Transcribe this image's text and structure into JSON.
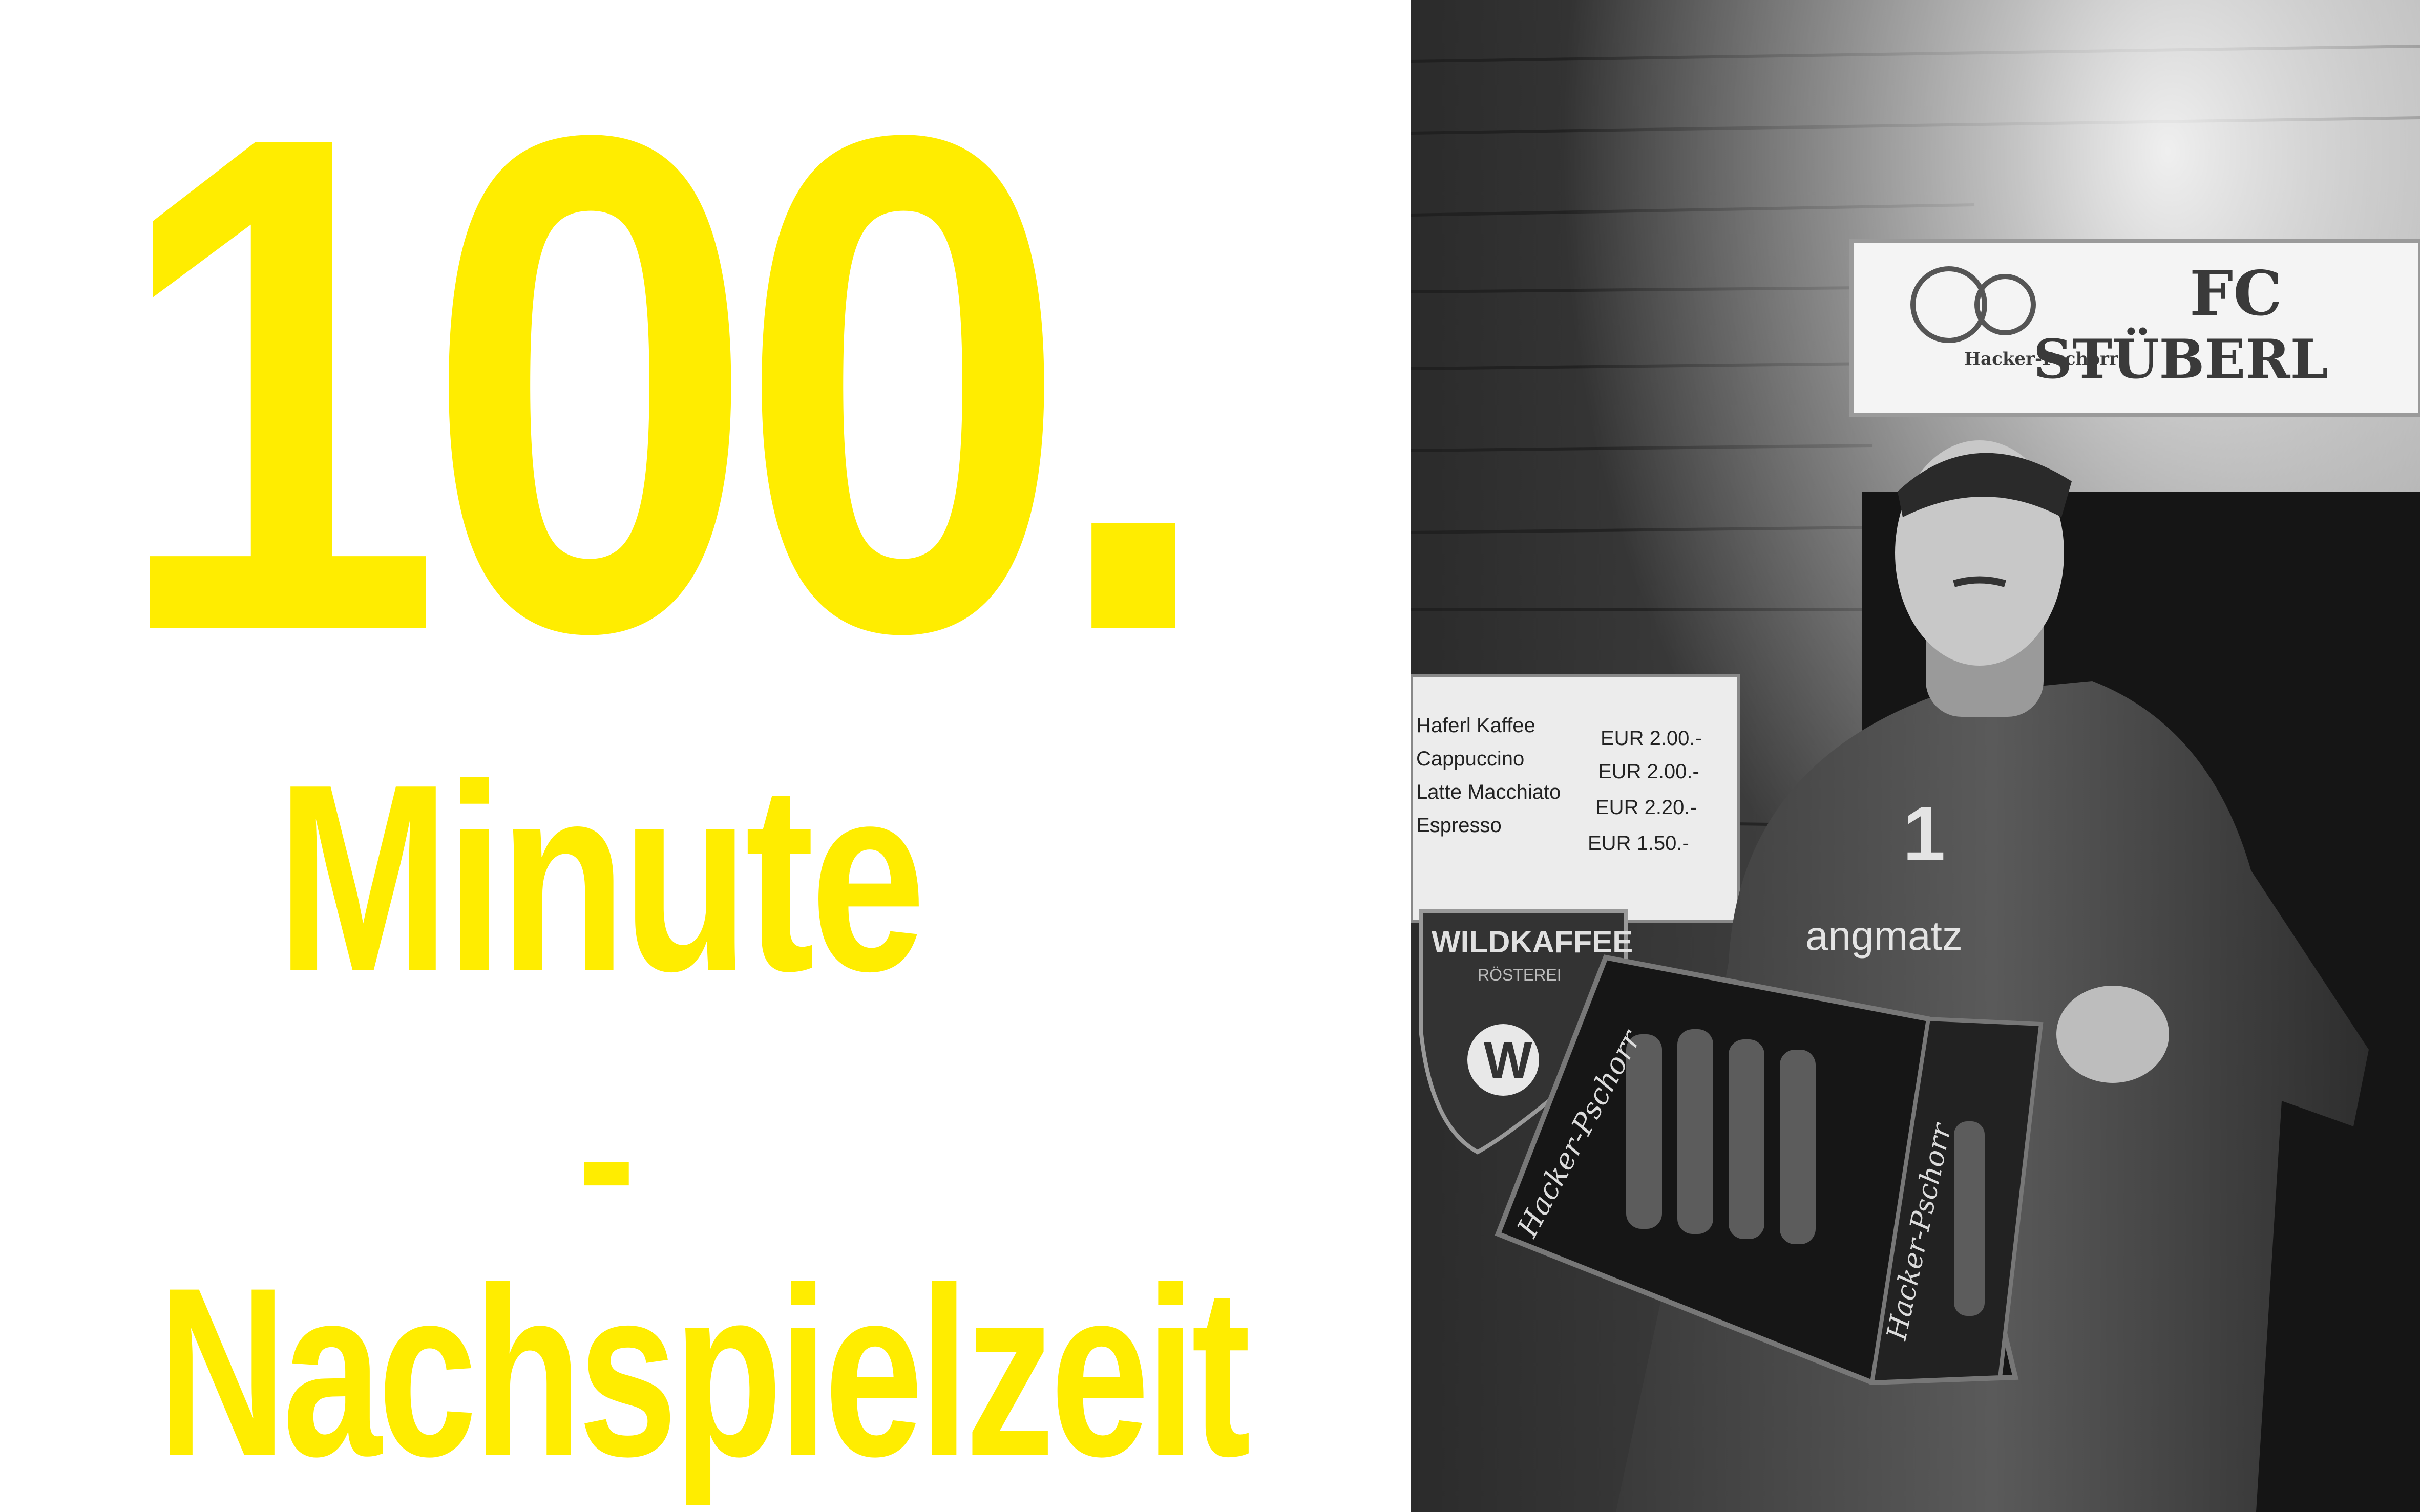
{
  "headline": {
    "number": "100.",
    "word": "Minute",
    "dash": "-",
    "subtitle": "Nachspielzeit",
    "color": "#ffed00"
  },
  "photo": {
    "sign": {
      "line1": "FC",
      "line2": "STÜBERL",
      "brand": "Hacker-Pschorr"
    },
    "menu": [
      {
        "item": "Haferl Kaffee",
        "price": "EUR  2.00.-"
      },
      {
        "item": "Cappuccino",
        "price": "EUR  2.00.-"
      },
      {
        "item": "Latte Macchiato",
        "price": "EUR  2.20.-"
      },
      {
        "item": "Espresso",
        "price": "EUR  1.50.-"
      }
    ],
    "poster": {
      "title": "WILDKAFFEE",
      "subtitle": "RÖSTEREI",
      "logo_letter": "W"
    },
    "jersey": {
      "number": "1",
      "sponsor": "angmatz"
    },
    "crate": {
      "brand": "Hacker-Pschorr"
    }
  }
}
